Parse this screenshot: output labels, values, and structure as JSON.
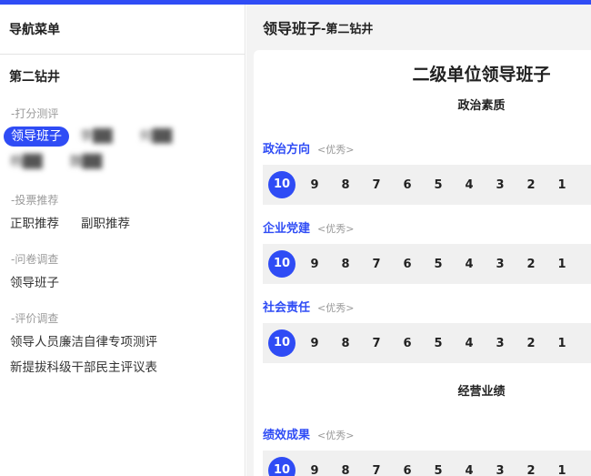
{
  "sidebar": {
    "title": "导航菜单",
    "unit": "第二钻井",
    "sections": [
      {
        "label": "-打分测评",
        "items": [
          "领导班子",
          "李██",
          "何██",
          "杨██",
          "魏██"
        ]
      },
      {
        "label": "-投票推荐",
        "items": [
          "正职推荐",
          "副职推荐"
        ]
      },
      {
        "label": "-问卷调查",
        "items": [
          "领导班子"
        ]
      },
      {
        "label": "-评价调查",
        "items": [
          "领导人员廉洁自律专项测评",
          "新提拔科级干部民主评议表"
        ]
      }
    ]
  },
  "main": {
    "title": "领导班子",
    "subtitle": "-第二钻井",
    "card_title": "二级单位领导班子",
    "groups": [
      "政治素质",
      "经营业绩"
    ],
    "items": [
      {
        "name": "政治方向",
        "hint": "<优秀>",
        "selected": "10"
      },
      {
        "name": "企业党建",
        "hint": "<优秀>",
        "selected": "10"
      },
      {
        "name": "社会责任",
        "hint": "<优秀>",
        "selected": "10"
      },
      {
        "name": "绩效成果",
        "hint": "<优秀>",
        "selected": "10"
      }
    ],
    "scores": [
      "10",
      "9",
      "8",
      "7",
      "6",
      "5",
      "4",
      "3",
      "2",
      "1"
    ]
  },
  "colors": {
    "accent": "#2f4cf5",
    "hint": "#999999"
  }
}
